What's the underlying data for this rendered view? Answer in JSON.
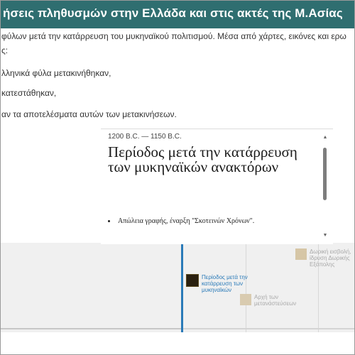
{
  "header": {
    "title": "ήσεις πληθυσμών στην Ελλάδα και στις ακτές της Μ.Ασίας"
  },
  "intro": {
    "line1": "φύλων μετά την κατάρρευση του μυκηναϊκού πολιτισμού. Μέσα από χάρτες, εικόνες και ερω",
    "line2": "ς:",
    "line3": "λληνικά φύλα μετακινήθηκαν,",
    "line4": "κατεστάθηκαν,",
    "line5": "αν τα αποτελέσματα αυτών των μετακινήσεων."
  },
  "card": {
    "date": "1200 B.C. — 1150 B.C.",
    "title": "Περίοδος μετά την κατάρρευση των μυκηναϊκών ανακτόρων",
    "bullets": [
      "Απώλεια γραφής, έναρξη \"Σκοτεινών Χρόνων\"."
    ]
  },
  "scrollbar": {
    "up_icon": "▲",
    "down_icon": "▼"
  },
  "timeline": {
    "events": [
      {
        "label": "Περίοδος μετά την κατάρρευση των μυκηναϊκών",
        "state": "selected"
      },
      {
        "label": "Αρχή των μετανάστεύσεων",
        "state": "normal"
      },
      {
        "label": "Δωρική εισβολή, ίδρυση Δωρικής Εξάπολης",
        "state": "normal"
      }
    ]
  },
  "colors": {
    "header_bg": "#2f6e70",
    "accent_blue": "#2a7ab8",
    "timeline_bg": "#f0f0f0"
  },
  "icons": {
    "scroll_up": "triangle-up-icon",
    "scroll_down": "triangle-down-icon",
    "event_thumbnail": "image-thumbnail-icon"
  }
}
